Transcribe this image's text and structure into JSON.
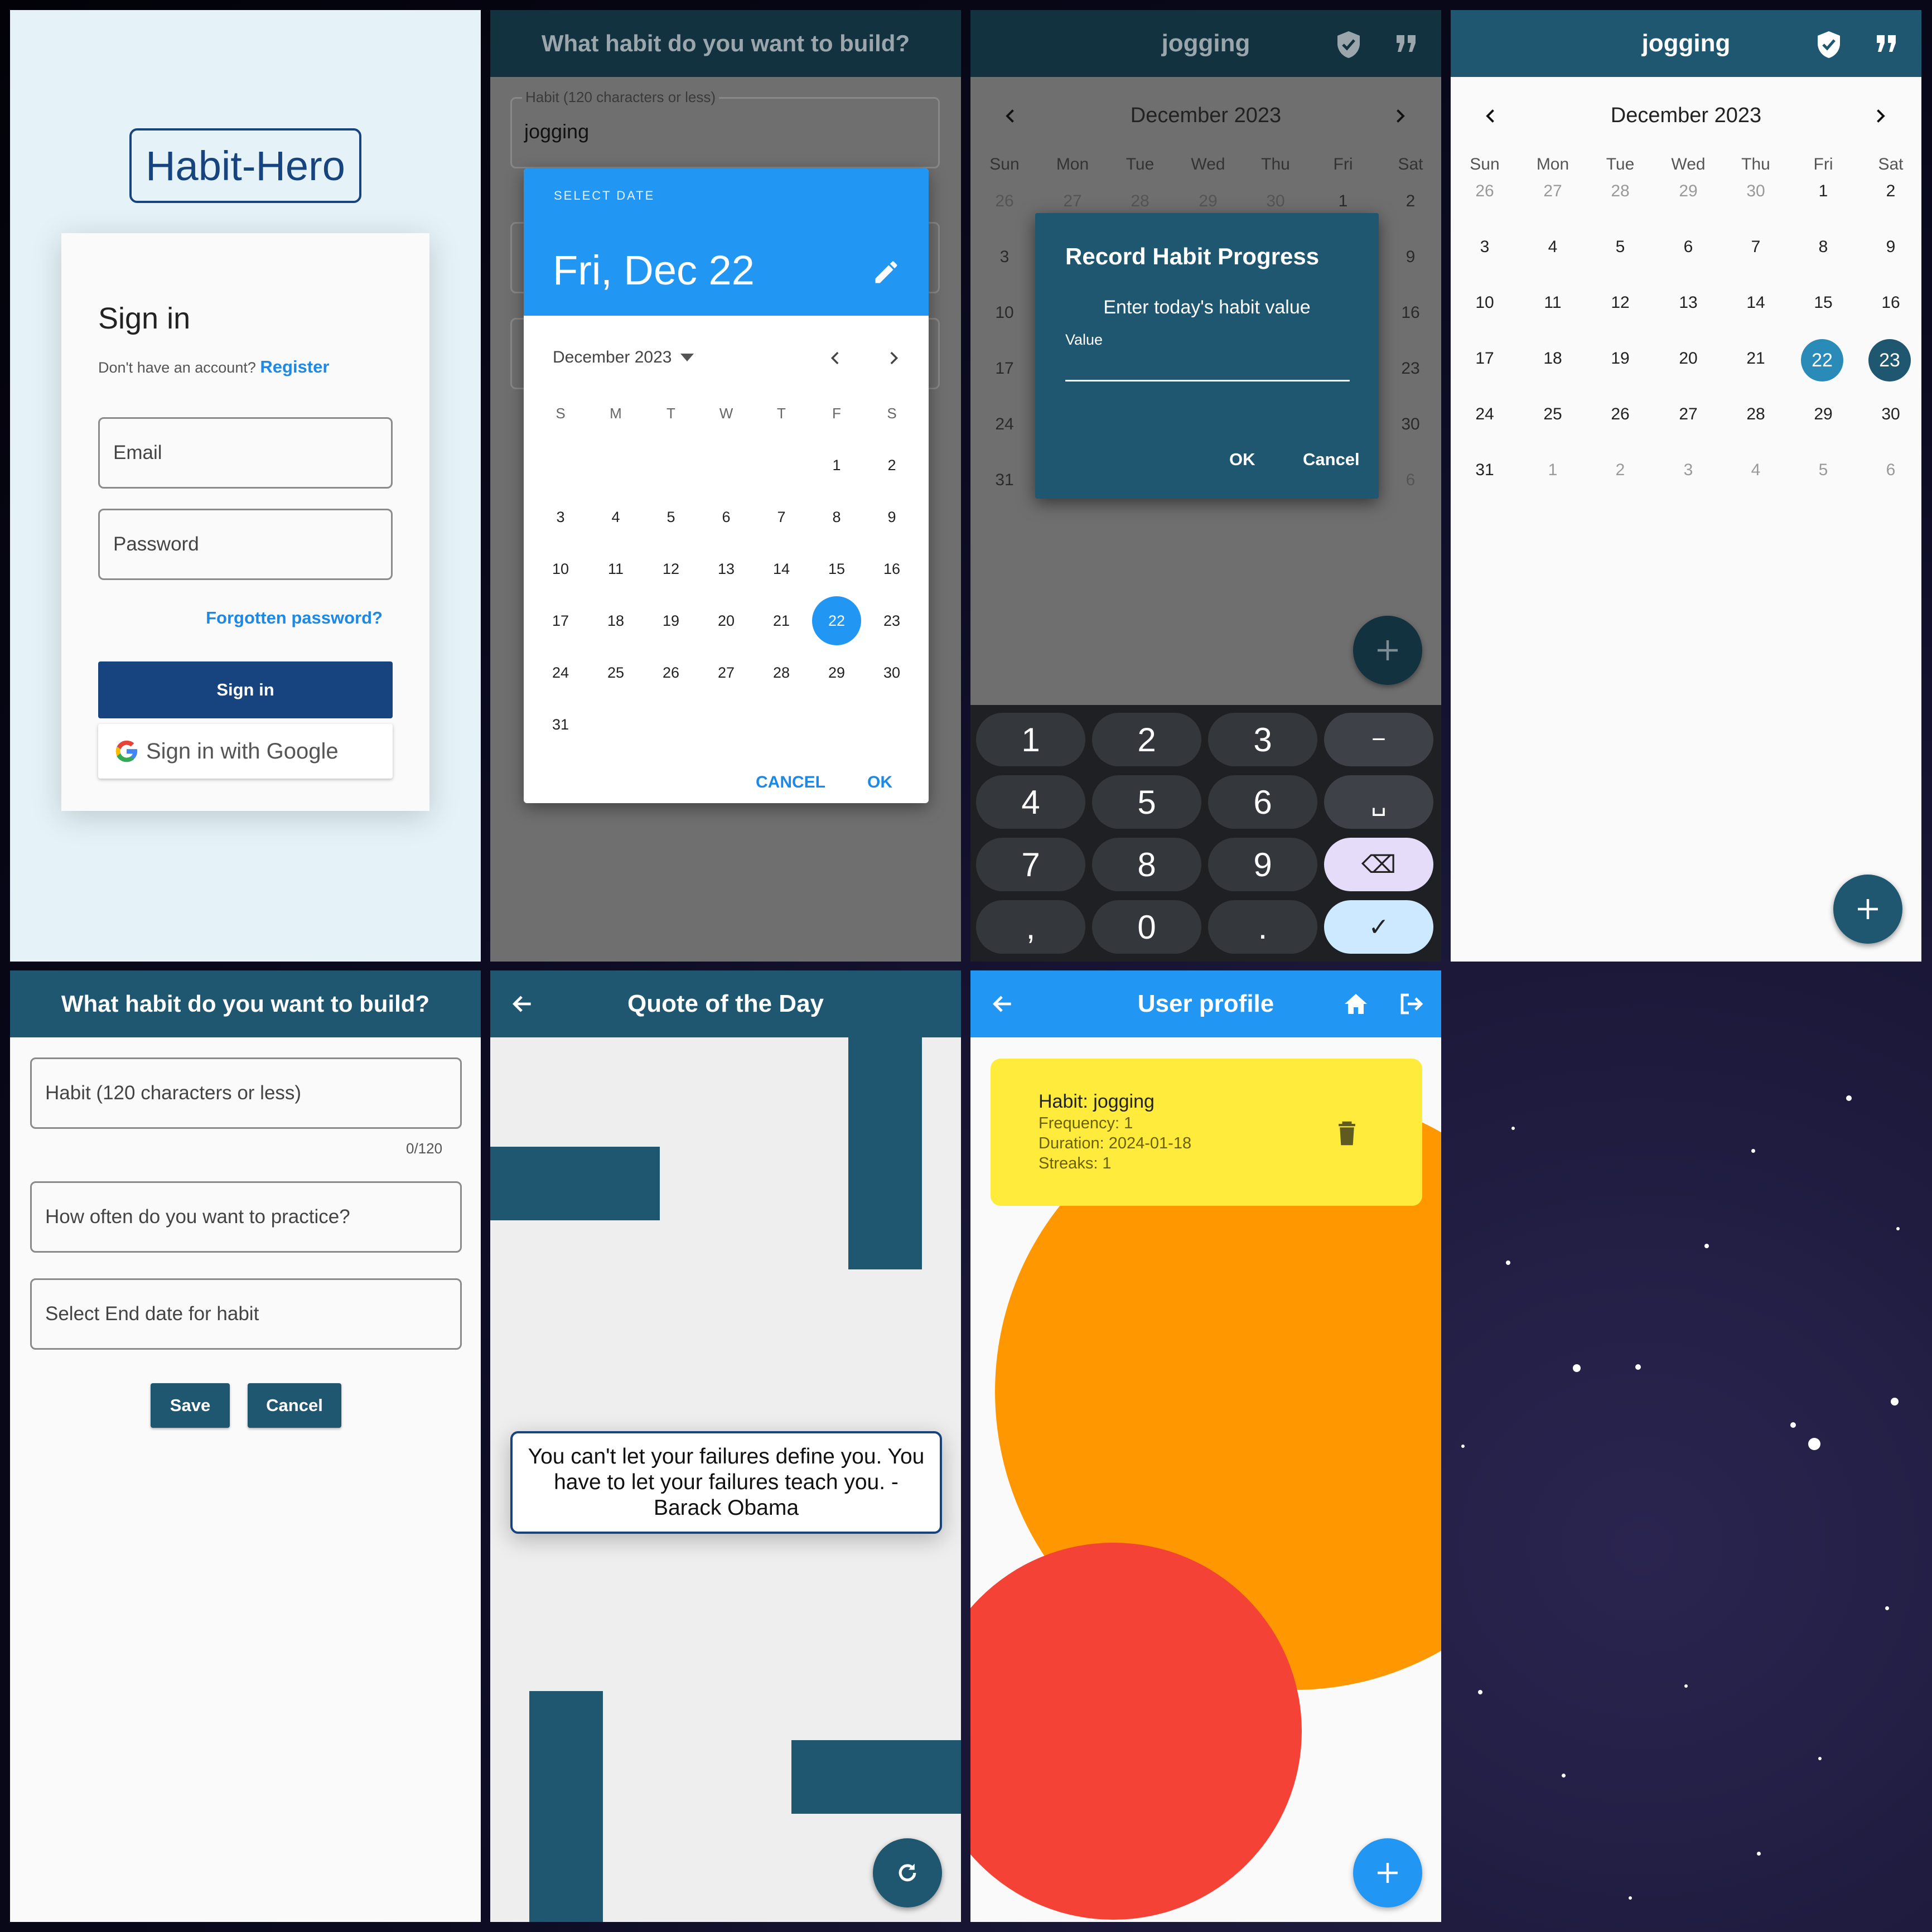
{
  "signin": {
    "logo": "Habit-Hero",
    "title": "Sign in",
    "no_account": "Don't have an account?",
    "register": "Register",
    "email_placeholder": "Email",
    "password_placeholder": "Password",
    "forgot": "Forgotten password?",
    "signin_button": "Sign in",
    "google_button": "Sign in with Google"
  },
  "datepicker": {
    "appbar_title": "What habit do you want to build?",
    "habit_label": "Habit (120 characters or less)",
    "habit_value": "jogging",
    "header_label": "SELECT DATE",
    "selected_date": "Fri, Dec 22",
    "month": "December 2023",
    "weekdays": [
      "S",
      "M",
      "T",
      "W",
      "T",
      "F",
      "S"
    ],
    "days": [
      "1",
      "2",
      "3",
      "4",
      "5",
      "6",
      "7",
      "8",
      "9",
      "10",
      "11",
      "12",
      "13",
      "14",
      "15",
      "16",
      "17",
      "18",
      "19",
      "20",
      "21",
      "22",
      "23",
      "24",
      "25",
      "26",
      "27",
      "28",
      "29",
      "30",
      "31"
    ],
    "selected_day": "22",
    "cancel": "CANCEL",
    "ok": "OK"
  },
  "progress": {
    "appbar_title": "jogging",
    "month": "December 2023",
    "weekdays": [
      "Sun",
      "Mon",
      "Tue",
      "Wed",
      "Thu",
      "Fri",
      "Sat"
    ],
    "left_col": [
      "26",
      "3",
      "10",
      "17",
      "24",
      "31"
    ],
    "right_col": [
      "2",
      "9",
      "16",
      "23",
      "30",
      "6"
    ],
    "top_row": [
      "27",
      "28",
      "29",
      "30",
      "1"
    ],
    "dialog_title": "Record Habit Progress",
    "dialog_subtitle": "Enter today's habit value",
    "value_label": "Value",
    "ok": "OK",
    "cancel": "Cancel",
    "keys": [
      "1",
      "2",
      "3",
      "−",
      "4",
      "5",
      "6",
      "␣",
      "7",
      "8",
      "9",
      "⌫",
      ",",
      "0",
      ".",
      "✓"
    ]
  },
  "calendar": {
    "appbar_title": "jogging",
    "month": "December 2023",
    "weekdays": [
      "Sun",
      "Mon",
      "Tue",
      "Wed",
      "Thu",
      "Fri",
      "Sat"
    ],
    "rows": [
      [
        "26",
        "27",
        "28",
        "29",
        "30",
        "1",
        "2"
      ],
      [
        "3",
        "4",
        "5",
        "6",
        "7",
        "8",
        "9"
      ],
      [
        "10",
        "11",
        "12",
        "13",
        "14",
        "15",
        "16"
      ],
      [
        "17",
        "18",
        "19",
        "20",
        "21",
        "22",
        "23"
      ],
      [
        "24",
        "25",
        "26",
        "27",
        "28",
        "29",
        "30"
      ],
      [
        "31",
        "1",
        "2",
        "3",
        "4",
        "5",
        "6"
      ]
    ],
    "highlight_a": "22",
    "highlight_b": "23"
  },
  "newhabit": {
    "appbar_title": "What habit do you want to build?",
    "habit_placeholder": "Habit (120 characters or less)",
    "counter": "0/120",
    "frequency_placeholder": "How often do you want to practice?",
    "enddate_placeholder": "Select End date for habit",
    "save": "Save",
    "cancel": "Cancel"
  },
  "quote": {
    "appbar_title": "Quote of the Day",
    "text": "You can't let your failures define you. You have to let your failures teach you. - Barack Obama"
  },
  "profile": {
    "appbar_title": "User profile",
    "habit": "Habit: jogging",
    "frequency": "Frequency: 1",
    "duration": "Duration: 2024-01-18",
    "streaks": "Streaks: 1"
  },
  "colors": {
    "primary": "#1f5670",
    "navy": "#17437f",
    "blue": "#2196f3",
    "yellow": "#ffeb3b",
    "orange": "#ff9800",
    "red": "#f44336"
  }
}
